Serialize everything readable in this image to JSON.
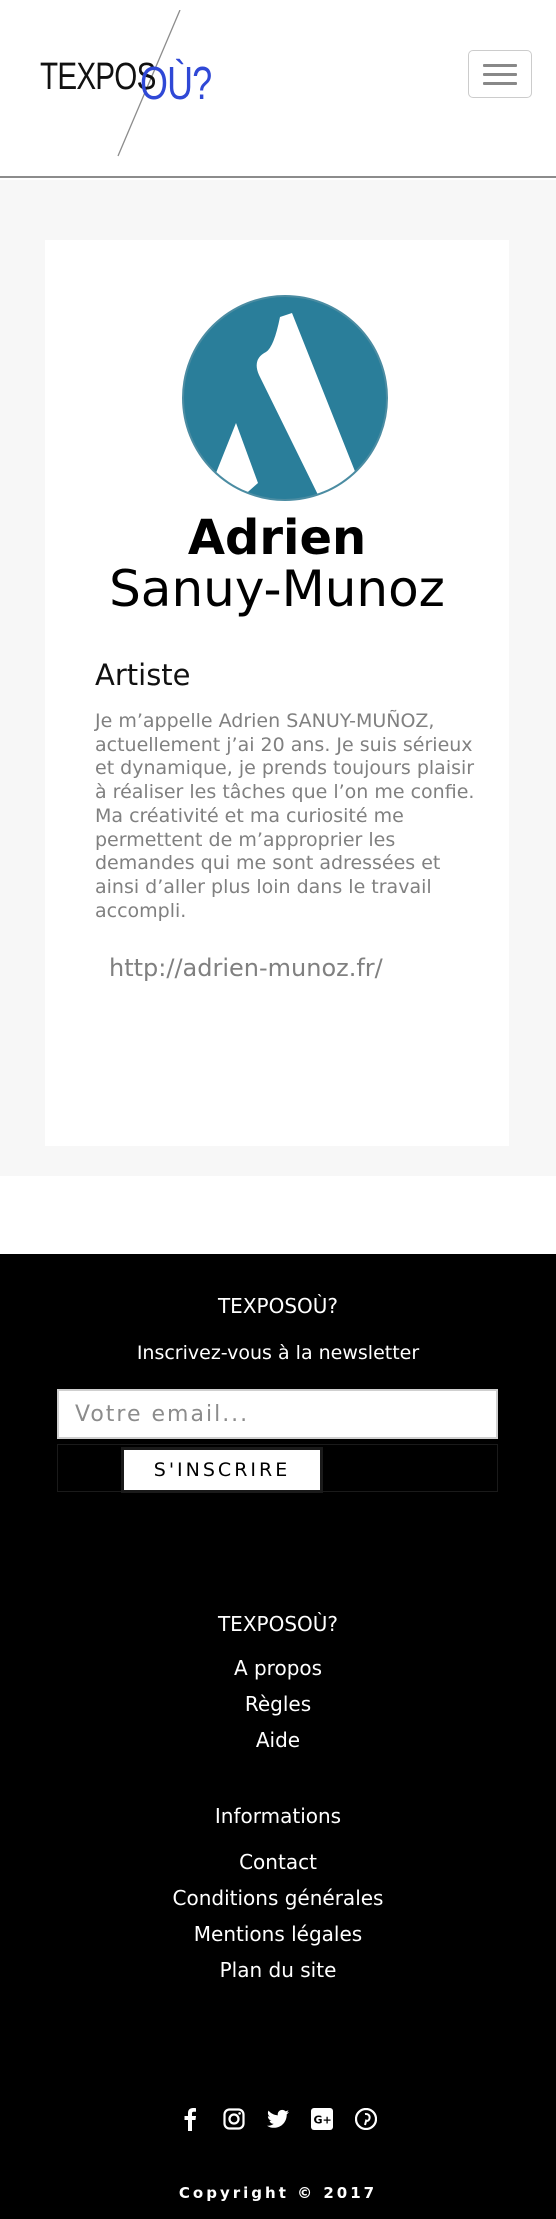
{
  "header": {
    "logo_part1": "TEXPOS",
    "logo_part2": "OÙ?",
    "accent_color": "#2f48d6"
  },
  "profile": {
    "first_name": "Adrien",
    "last_name": "Sanuy-Munoz",
    "role": "Artiste",
    "bio": "Je m’appelle Adrien SANUY-MUÑOZ, actuellement j’ai 20 ans. Je suis sérieux et dynamique, je prends toujours plaisir à réaliser les tâches que l’on me confie. Ma créativité et ma curiosité me permettent de m’approprier les demandes qui me sont adressées et ainsi d’aller plus loin dans le travail accompli.",
    "website": "http://adrien-munoz.fr/",
    "avatar_color": "#2a7e9a"
  },
  "footer": {
    "brand": "TEXPOSOÙ?",
    "newsletter_title": "Inscrivez-vous à la newsletter",
    "email_placeholder": "Votre email...",
    "subscribe_label": "S'INSCRIRE",
    "brand2": "TEXPOSOÙ?",
    "links1": [
      "A propos",
      "Règles",
      "Aide"
    ],
    "info_title": "Informations",
    "links2": [
      "Contact",
      "Conditions générales",
      "Mentions légales",
      "Plan du site"
    ],
    "social_icons": [
      "facebook-icon",
      "instagram-icon",
      "twitter-icon",
      "google-plus-icon",
      "pinterest-icon"
    ],
    "copyright": "Copyright © 2017"
  }
}
